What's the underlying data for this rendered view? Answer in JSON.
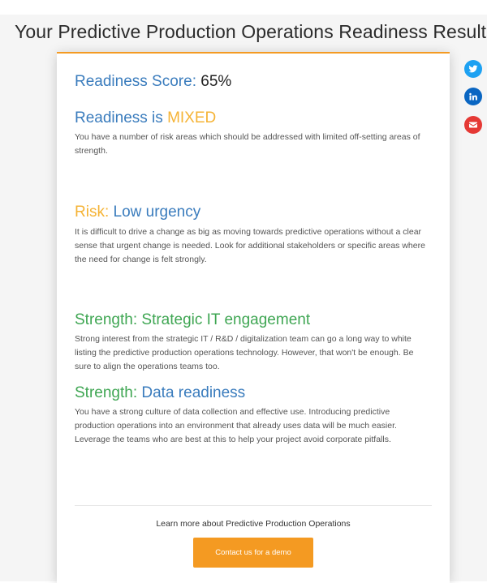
{
  "page": {
    "title": "Your Predictive Production Operations Readiness Results"
  },
  "score": {
    "label": "Readiness Score:",
    "value": "65%"
  },
  "readiness": {
    "heading_prefix": "Readiness is",
    "heading_value": "MIXED",
    "description": "You have a number of risk areas which should be addressed with limited off-setting areas of strength."
  },
  "results": [
    {
      "type": "Risk:",
      "name": "Low urgency",
      "description": "It is difficult to drive a change as big as moving towards predictive operations without a clear sense that urgent change is needed. Look for additional stakeholders or specific areas where the need for change is felt strongly."
    },
    {
      "type": "Strength:",
      "name": "Strategic IT engagement",
      "description": "Strong interest from the strategic IT / R&D / digitalization team can go a long way to white listing the predictive production operations technology. However, that won't be enough. Be sure to align the operations teams too."
    },
    {
      "type": "Strength:",
      "name": "Data readiness",
      "description": "You have a strong culture of data collection and effective use. Introducing predictive production operations into an environment that already uses data will be much easier. Leverage the teams who are best at this to help your project avoid corporate pitfalls."
    }
  ],
  "footer": {
    "learn_more": "Learn more about Predictive Production Operations",
    "cta_label": "Contact us for a demo"
  },
  "social": [
    {
      "icon": "twitter-icon",
      "color": "#1da1f2"
    },
    {
      "icon": "linkedin-icon",
      "color": "#0a66c2"
    },
    {
      "icon": "email-icon",
      "color": "#e53935"
    }
  ],
  "colors": {
    "accent": "#f49a22",
    "blue": "#3a7cbd",
    "orange": "#f5b335",
    "green": "#3fa653"
  }
}
